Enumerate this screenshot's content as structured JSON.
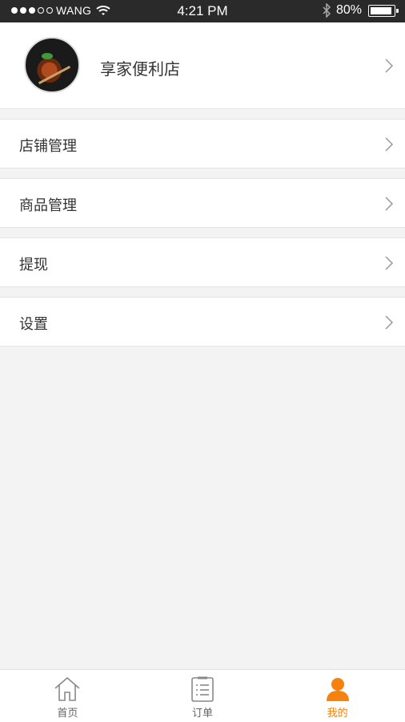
{
  "status_bar": {
    "carrier": "WANG",
    "time": "4:21 PM",
    "battery": "80%"
  },
  "profile": {
    "store_name": "享家便利店"
  },
  "menu": {
    "items": [
      {
        "label": "店铺管理"
      },
      {
        "label": "商品管理"
      },
      {
        "label": "提现"
      },
      {
        "label": "设置"
      }
    ]
  },
  "tab_bar": {
    "tabs": [
      {
        "label": "首页",
        "icon": "home-icon"
      },
      {
        "label": "订单",
        "icon": "order-list-icon"
      },
      {
        "label": "我的",
        "icon": "user-icon",
        "active": true
      }
    ],
    "active_color": "#f5820c"
  }
}
